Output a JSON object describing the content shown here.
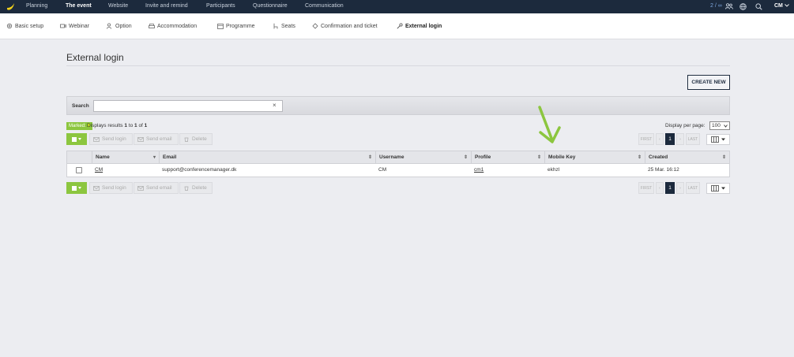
{
  "topnav": {
    "items": [
      "Planning",
      "The event",
      "Website",
      "Invite and remind",
      "Participants",
      "Questionnaire",
      "Communication"
    ],
    "active": "The event",
    "counter": "2 / ∞",
    "user": "CM"
  },
  "subnav": {
    "items": [
      "Basic setup",
      "Webinar",
      "Option",
      "Accommodation",
      "Programme",
      "Seats",
      "Confirmation and ticket",
      "External login"
    ],
    "active": "External login"
  },
  "page": {
    "title": "External login",
    "create_button": "CREATE NEW"
  },
  "search": {
    "label": "Search",
    "value": "",
    "clear": "×"
  },
  "status": {
    "marked_label": "Marked:",
    "marked_count": "0",
    "results_prefix": "Displays results",
    "results_from": "1",
    "results_to_word": "to",
    "results_to": "1",
    "results_of_word": "of",
    "results_total": "1",
    "per_page_label": "Display per page:",
    "per_page_value": "100"
  },
  "toolbar": {
    "send_login": "Send login",
    "send_email": "Send email",
    "delete": "Delete",
    "first": "FIRST",
    "prev": "‹",
    "page": "1",
    "next": "›",
    "last": "LAST"
  },
  "table": {
    "columns": [
      "Name",
      "Email",
      "Username",
      "Profile",
      "Mobile Key",
      "Created"
    ],
    "rows": [
      {
        "name": "CM",
        "email": "support@conferencemanager.dk",
        "username": "CM",
        "profile": "cm1",
        "mobile_key": "ekhzl",
        "created": "25 Mar. 16:12"
      }
    ]
  },
  "colors": {
    "nav_bg": "#1c2a3d",
    "accent_green": "#8cc63f",
    "arrow_green": "#8cc63f"
  }
}
